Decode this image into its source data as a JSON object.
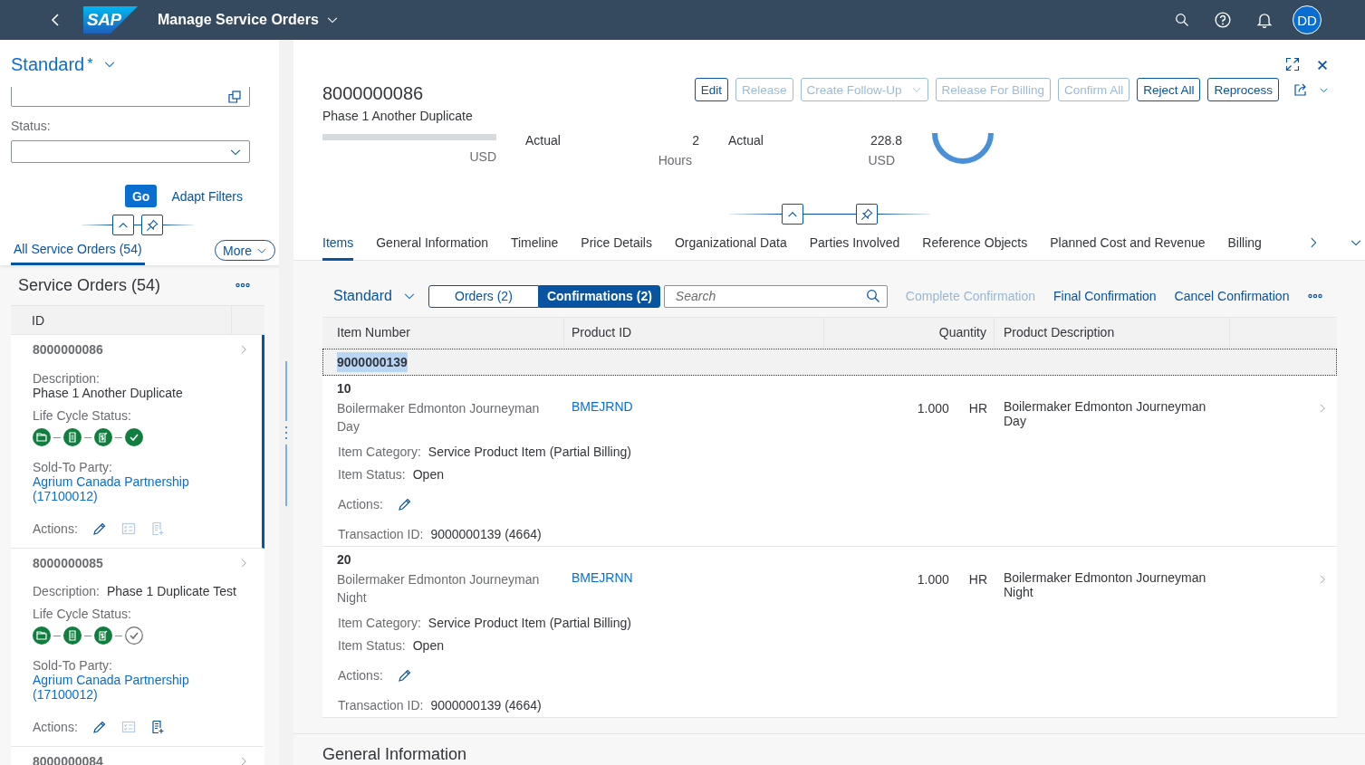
{
  "shell": {
    "logo": "SAP",
    "title": "Manage Service Orders",
    "avatar": "DD"
  },
  "filter_bar": {
    "variant": "Standard",
    "modified_mark": "*",
    "fields": [
      {
        "kind": "value-help"
      },
      {
        "kind": "select",
        "label": "Status:"
      }
    ],
    "go": "Go",
    "adapt": "Adapt Filters",
    "tabs": [
      {
        "label": "All Service Orders (54)",
        "selected": true
      }
    ],
    "more": "More"
  },
  "list": {
    "title": "Service Orders (54)",
    "column": "ID",
    "items": [
      {
        "id": "8000000086",
        "selected": true,
        "kind": "stacked",
        "description_label": "Description:",
        "description": "Phase 1 Another Duplicate",
        "status_label": "Life Cycle Status:",
        "steps": [
          {
            "kind": "folder",
            "done": true
          },
          {
            "kind": "document",
            "done": true
          },
          {
            "kind": "invoice",
            "done": true
          },
          {
            "kind": "check",
            "done": true
          }
        ],
        "party_label": "Sold-To Party:",
        "party": "Agrium Canada Partnership (17100012)",
        "actions_label": "Actions:",
        "actions": [
          {
            "kind": "edit",
            "disabled": false
          },
          {
            "kind": "checklist",
            "disabled": true
          },
          {
            "kind": "add-list",
            "disabled": true
          }
        ]
      },
      {
        "id": "8000000085",
        "selected": false,
        "kind": "inline",
        "description_label": "Description:",
        "description": "Phase 1 Duplicate Test",
        "status_label": "Life Cycle Status:",
        "steps": [
          {
            "kind": "folder",
            "done": true
          },
          {
            "kind": "document",
            "done": true
          },
          {
            "kind": "invoice",
            "done": true
          },
          {
            "kind": "check",
            "done": false
          }
        ],
        "party_label": "Sold-To Party:",
        "party": "Agrium Canada Partnership (17100012)",
        "actions_label": "Actions:",
        "actions": [
          {
            "kind": "edit",
            "disabled": false
          },
          {
            "kind": "checklist",
            "disabled": true
          },
          {
            "kind": "add-list",
            "disabled": false
          }
        ]
      },
      {
        "id": "8000000084",
        "selected": false,
        "kind": "stacked"
      }
    ]
  },
  "object": {
    "title": "8000000086",
    "subtitle": "Phase 1 Another Duplicate",
    "actions": [
      {
        "label": "Edit",
        "kind": "button",
        "disabled": false
      },
      {
        "label": "Release",
        "kind": "button",
        "disabled": true
      },
      {
        "label": "Create Follow-Up",
        "kind": "menu",
        "disabled": true
      },
      {
        "label": "Release For Billing",
        "kind": "button",
        "disabled": true
      },
      {
        "label": "Confirm All",
        "kind": "button",
        "disabled": true
      },
      {
        "label": "Reject All",
        "kind": "button",
        "disabled": false
      },
      {
        "label": "Reprocess",
        "kind": "button",
        "disabled": false
      }
    ],
    "kpis": [
      {
        "kind": "bar",
        "level": 0,
        "unit": "USD"
      },
      {
        "kind": "value",
        "label": "Actual",
        "value": "2",
        "unit": "Hours"
      },
      {
        "kind": "value",
        "label": "Actual",
        "value": "228.8",
        "unit": "USD"
      },
      {
        "kind": "ring"
      }
    ],
    "tabs": [
      {
        "label": "Items",
        "selected": true
      },
      {
        "label": "General Information",
        "selected": false
      },
      {
        "label": "Timeline",
        "selected": false
      },
      {
        "label": "Price Details",
        "selected": false
      },
      {
        "label": "Organizational Data",
        "selected": false
      },
      {
        "label": "Parties Involved",
        "selected": false
      },
      {
        "label": "Reference Objects",
        "selected": false
      },
      {
        "label": "Planned Cost and Revenue",
        "selected": false
      },
      {
        "label": "Billing",
        "selected": false
      }
    ],
    "items_table": {
      "variant": "Standard",
      "segments": [
        {
          "label": "Orders (2)",
          "selected": false
        },
        {
          "label": "Confirmations (2)",
          "selected": true
        }
      ],
      "search_placeholder": "Search",
      "actions": [
        {
          "label": "Complete Confirmation",
          "disabled": true
        },
        {
          "label": "Final Confirmation",
          "disabled": false
        },
        {
          "label": "Cancel Confirmation",
          "disabled": false
        }
      ],
      "columns": [
        "Item Number",
        "Product ID",
        "Quantity",
        "Product Description"
      ],
      "group": "9000000139",
      "rows": [
        {
          "number": "10",
          "description": "Boilermaker Edmonton Journeyman Day",
          "product_id": "BMEJRND",
          "quantity": "1.000",
          "unit": "HR",
          "product_description": "Boilermaker Edmonton Journeyman Day",
          "details": [
            {
              "kind": "text",
              "label": "Item Category:",
              "value": "Service Product Item (Partial Billing)"
            },
            {
              "kind": "text",
              "label": "Item Status:",
              "value": "Open"
            },
            {
              "kind": "actions",
              "label": "Actions:"
            },
            {
              "kind": "text",
              "label": "Transaction ID:",
              "value": "9000000139 (4664)"
            }
          ]
        },
        {
          "number": "20",
          "description": "Boilermaker Edmonton Journeyman Night",
          "product_id": "BMEJRNN",
          "quantity": "1.000",
          "unit": "HR",
          "product_description": "Boilermaker Edmonton Journeyman Night",
          "details": [
            {
              "kind": "text",
              "label": "Item Category:",
              "value": "Service Product Item (Partial Billing)"
            },
            {
              "kind": "text",
              "label": "Item Status:",
              "value": "Open"
            },
            {
              "kind": "actions",
              "label": "Actions:"
            },
            {
              "kind": "text",
              "label": "Transaction ID:",
              "value": "9000000139 (4664)"
            }
          ]
        }
      ]
    },
    "next_section": "General Information"
  }
}
